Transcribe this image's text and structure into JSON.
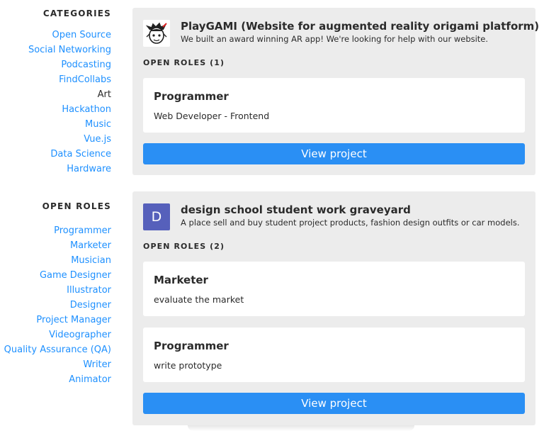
{
  "sidebar": {
    "categories_title": "CATEGORIES",
    "categories": [
      {
        "label": "Open Source"
      },
      {
        "label": "Social Networking"
      },
      {
        "label": "Podcasting"
      },
      {
        "label": "FindCollabs"
      },
      {
        "label": "Art"
      },
      {
        "label": "Hackathon"
      },
      {
        "label": "Music"
      },
      {
        "label": "Vue.js"
      },
      {
        "label": "Data Science"
      },
      {
        "label": "Hardware"
      }
    ],
    "active_category": "Art",
    "roles_title": "OPEN ROLES",
    "roles": [
      {
        "label": "Programmer"
      },
      {
        "label": "Marketer"
      },
      {
        "label": "Musician"
      },
      {
        "label": "Game Designer"
      },
      {
        "label": "Illustrator"
      },
      {
        "label": "Designer"
      },
      {
        "label": "Project Manager"
      },
      {
        "label": "Videographer"
      },
      {
        "label": "Quality Assurance (QA)"
      },
      {
        "label": "Writer"
      },
      {
        "label": "Animator"
      }
    ]
  },
  "projects": [
    {
      "logo": "origami-face-icon",
      "title": "PlayGAMI (Website for augmented reality origami platform)",
      "description": "We built an award winning AR app! We're looking for help with our website.",
      "roles_header": "OPEN ROLES (1)",
      "roles": [
        {
          "title": "Programmer",
          "description": "Web Developer - Frontend"
        }
      ],
      "button_label": "View project"
    },
    {
      "logo_letter": "D",
      "title": "design school student work graveyard",
      "description": "A place sell and buy student project products, fashion design outfits or car models.",
      "roles_header": "OPEN ROLES (2)",
      "roles": [
        {
          "title": "Marketer",
          "description": "evaluate the market"
        },
        {
          "title": "Programmer",
          "description": "write prototype"
        }
      ],
      "button_label": "View project"
    }
  ],
  "colors": {
    "link": "#1e90ff",
    "button": "#2a8ff4",
    "card_bg": "#ececec",
    "logo_d_bg": "#5660bb"
  }
}
